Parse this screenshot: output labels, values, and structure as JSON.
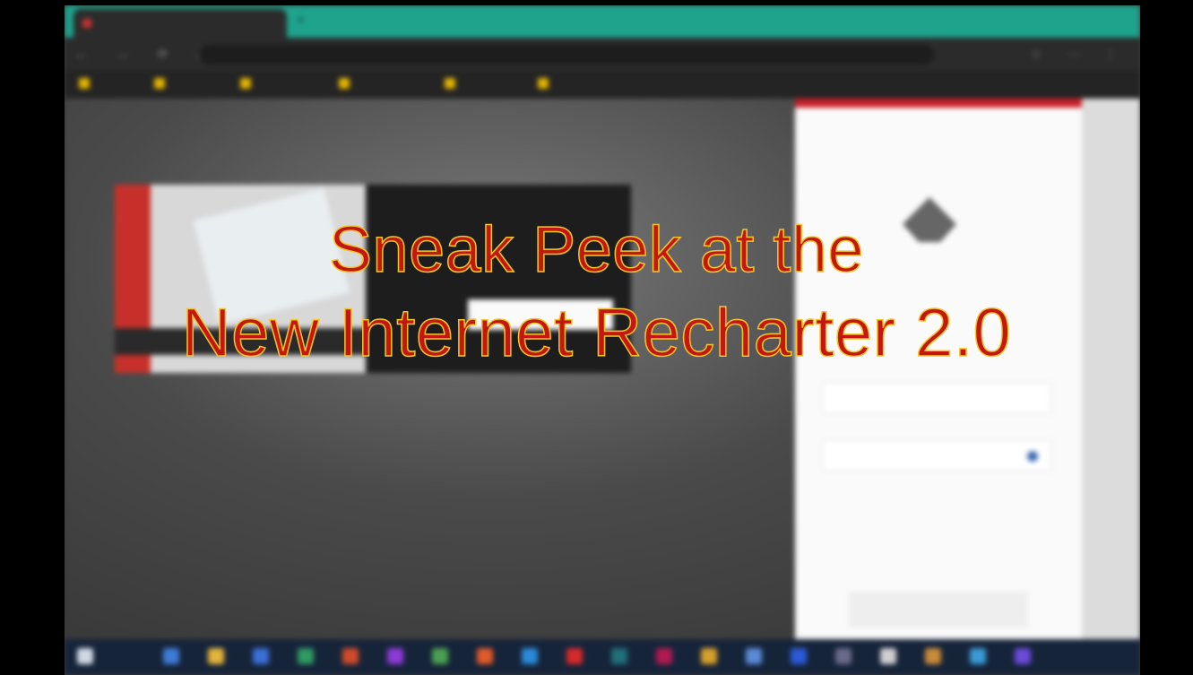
{
  "overlay": {
    "line1": "Sneak Peek at the",
    "line2": "New Internet Recharter 2.0",
    "text_color": "#c4170f",
    "outline_color": "#f2c62c"
  },
  "colors": {
    "tab_bar": "#1fa38d",
    "login_stripe": "#c8202a",
    "taskbar": "#16243a"
  }
}
